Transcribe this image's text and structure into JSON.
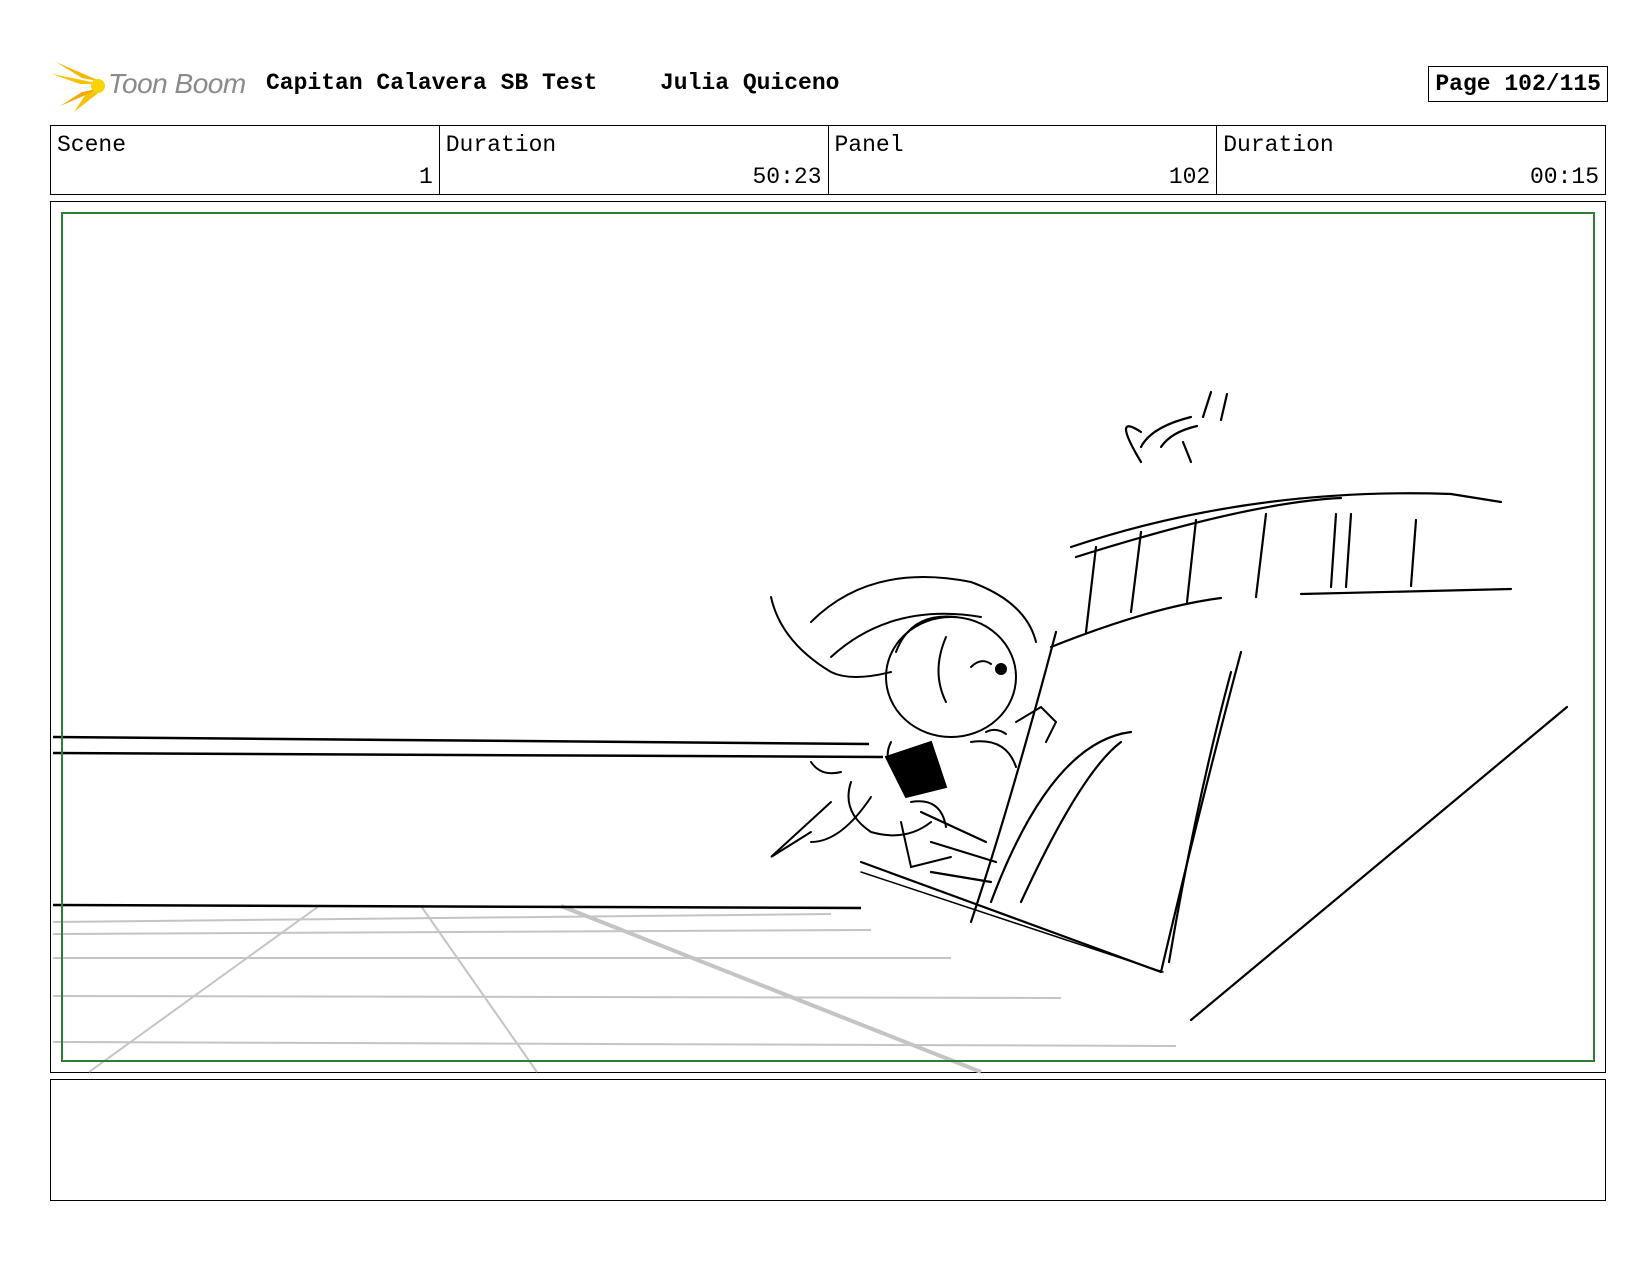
{
  "header": {
    "logo_text": "Toon Boom",
    "project_title": "Capitan Calavera SB Test",
    "author": "Julia Quiceno",
    "page_label": "Page 102/115"
  },
  "info": {
    "scene_label": "Scene",
    "scene_value": "1",
    "duration_label": "Duration",
    "duration_value": "50:23",
    "panel_label": "Panel",
    "panel_value": "102",
    "panel_duration_label": "Duration",
    "panel_duration_value": "00:15"
  },
  "colors": {
    "frame": "#2e7d32",
    "logo_yellow": "#f5b800",
    "logo_text": "#8a8a8a"
  },
  "notes": {
    "text": ""
  }
}
